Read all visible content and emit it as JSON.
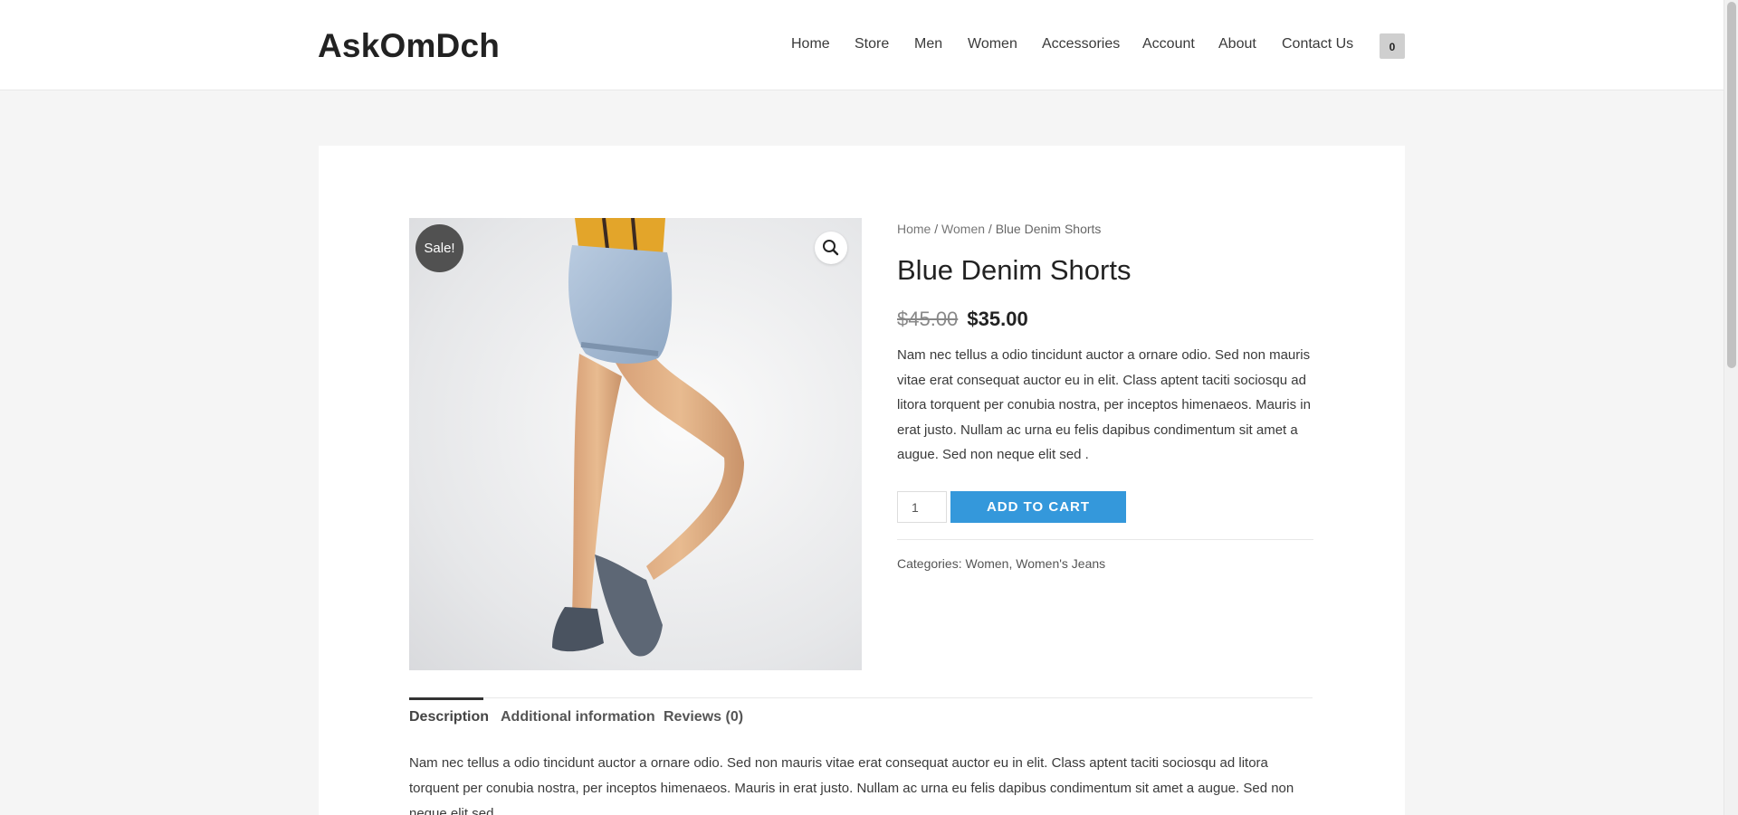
{
  "header": {
    "logo": "AskOmDch",
    "nav": [
      "Home",
      "Store",
      "Men",
      "Women",
      "Accessories",
      "Account",
      "About",
      "Contact Us"
    ],
    "cart_count": "0"
  },
  "product": {
    "sale_badge": "Sale!",
    "breadcrumb": {
      "home": "Home",
      "sep1": " / ",
      "women": "Women",
      "sep2": " / ",
      "current": "Blue Denim Shorts"
    },
    "title": "Blue Denim Shorts",
    "price_old": "$45.00",
    "price_new": "$35.00",
    "short_description": "Nam nec tellus a odio tincidunt auctor a ornare odio. Sed non mauris vitae erat consequat auctor eu in elit. Class aptent taciti sociosqu ad litora torquent per conubia nostra, per inceptos himenaeos. Mauris in erat justo. Nullam ac urna eu felis dapibus condimentum sit amet a augue. Sed non neque elit sed .",
    "quantity": "1",
    "add_to_cart": "ADD TO CART",
    "categories_label": "Categories: ",
    "category_1": "Women",
    "category_sep": ", ",
    "category_2": "Women's Jeans"
  },
  "tabs": {
    "description": "Description",
    "additional": "Additional information",
    "reviews": "Reviews (0)"
  },
  "description_text": "Nam nec tellus a odio tincidunt auctor a ornare odio. Sed non mauris vitae erat consequat auctor eu in elit. Class aptent taciti sociosqu ad litora torquent per conubia nostra, per inceptos himenaeos. Mauris in erat justo. Nullam ac urna eu felis dapibus condimentum sit amet a augue. Sed non neque elit sed .",
  "colors": {
    "accent": "#3498db",
    "sale_badge": "#515151"
  },
  "icons": [
    "search-icon",
    "cart-icon"
  ]
}
